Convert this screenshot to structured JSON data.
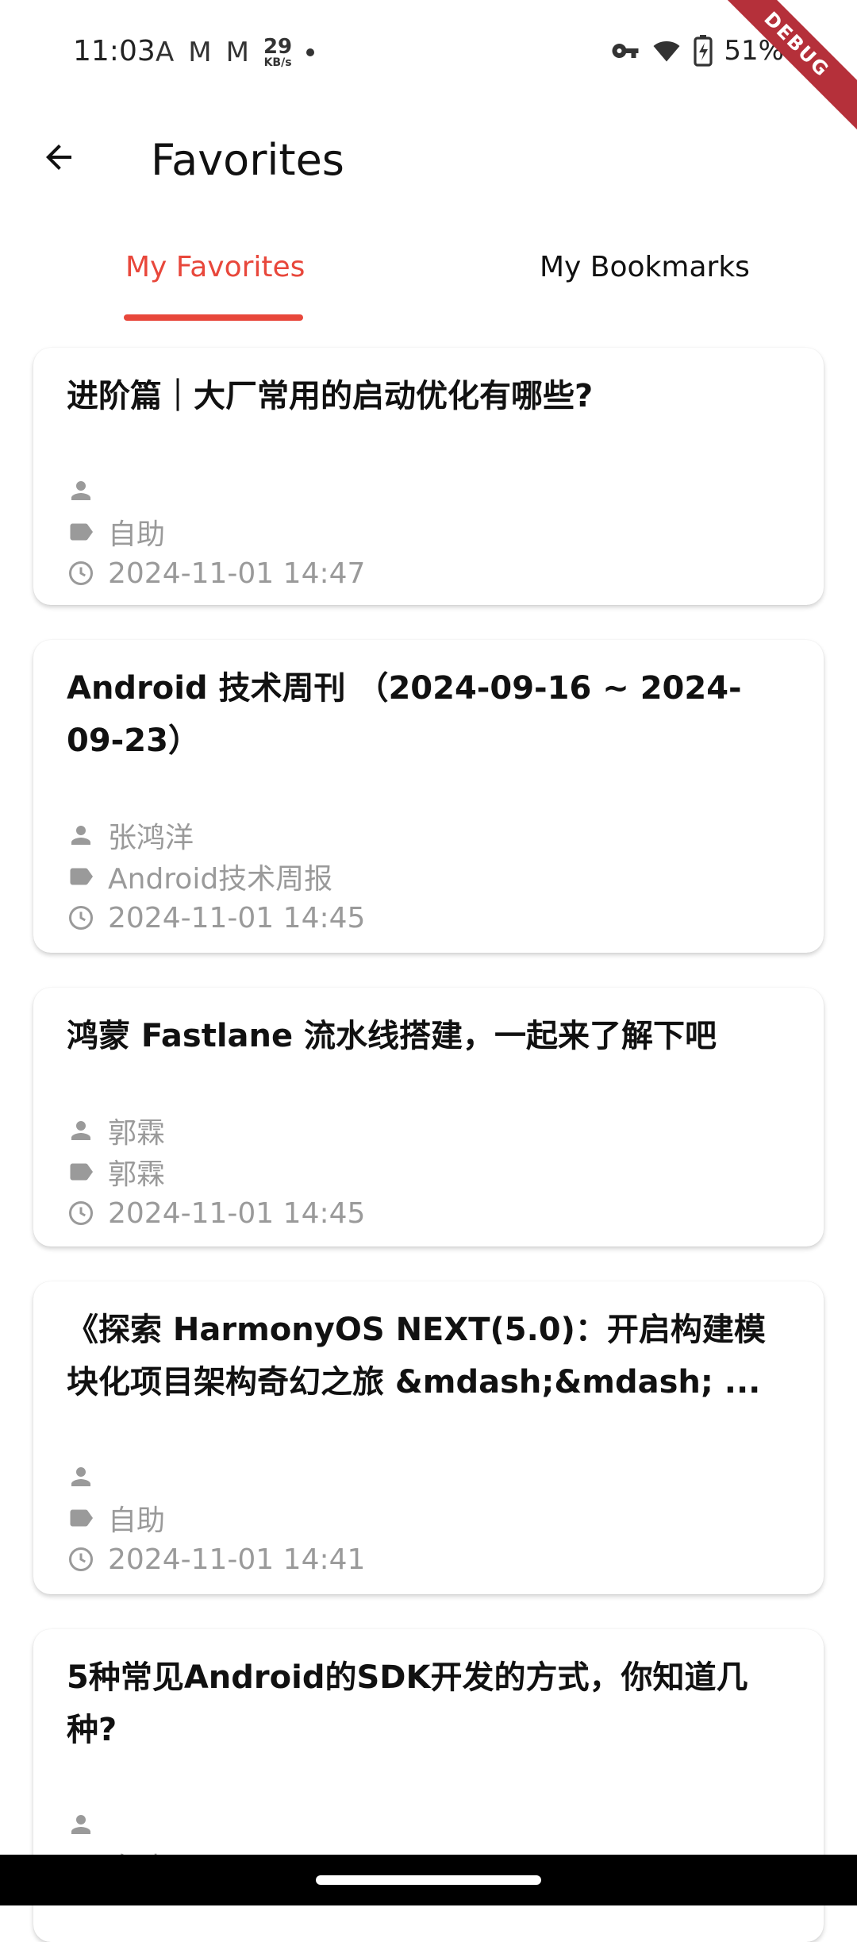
{
  "status_bar": {
    "time": "11:03",
    "speed_value": "29",
    "speed_unit": "KB/s",
    "battery": "51%"
  },
  "debug_label": "DEBUG",
  "app_bar": {
    "title": "Favorites"
  },
  "tabs": [
    {
      "label": "My Favorites",
      "selected": true
    },
    {
      "label": "My Bookmarks",
      "selected": false
    }
  ],
  "accent_color": "#e8473b",
  "items": [
    {
      "title": "进阶篇｜大厂常用的启动优化有哪些?",
      "author": "",
      "tag": "自助",
      "time": "2024-11-01 14:47"
    },
    {
      "title": "Android 技术周刊 （2024-09-16 ~ 2024-09-23）",
      "author": "张鸿洋",
      "tag": "Android技术周报",
      "time": "2024-11-01 14:45"
    },
    {
      "title": "鸿蒙 Fastlane 流水线搭建，一起来了解下吧",
      "author": "郭霖",
      "tag": "郭霖",
      "time": "2024-11-01 14:45"
    },
    {
      "title": "《探索 HarmonyOS NEXT(5.0)：开启构建模块化项目架构奇幻之旅 &mdash;&mdash; ...",
      "author": "",
      "tag": "自助",
      "time": "2024-11-01 14:41"
    },
    {
      "title": "5种常见Android的SDK开发的方式，你知道几种?",
      "author": "",
      "tag": "自助",
      "time": ""
    }
  ]
}
